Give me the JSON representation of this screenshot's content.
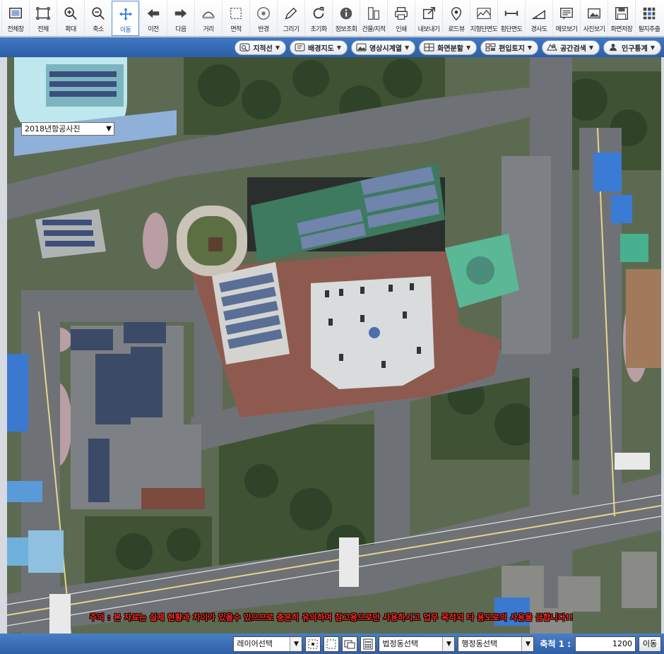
{
  "toolbar": {
    "tools": [
      {
        "label": "전체창",
        "icon": "fullwindow-icon"
      },
      {
        "label": "전체",
        "icon": "full-extent-icon"
      },
      {
        "label": "확대",
        "icon": "zoom-in-icon"
      },
      {
        "label": "축소",
        "icon": "zoom-out-icon"
      },
      {
        "label": "이동",
        "icon": "pan-move-icon",
        "active": true
      },
      {
        "label": "이전",
        "icon": "arrow-left-icon"
      },
      {
        "label": "다음",
        "icon": "arrow-right-icon"
      },
      {
        "label": "거리",
        "icon": "distance-measure-icon"
      },
      {
        "label": "면적",
        "icon": "area-measure-icon"
      },
      {
        "label": "반경",
        "icon": "radius-icon"
      },
      {
        "label": "그리기",
        "icon": "pencil-icon"
      },
      {
        "label": "초기화",
        "icon": "refresh-icon"
      },
      {
        "label": "정보조회",
        "icon": "info-icon"
      },
      {
        "label": "건물/지적",
        "icon": "building-icon"
      },
      {
        "label": "인쇄",
        "icon": "printer-icon"
      },
      {
        "label": "내보내기",
        "icon": "export-icon"
      },
      {
        "label": "로드뷰",
        "icon": "map-pin-icon"
      },
      {
        "label": "지형단면도",
        "icon": "terrain-profile-icon"
      },
      {
        "label": "횡단면도",
        "icon": "cross-section-icon"
      },
      {
        "label": "경사도",
        "icon": "slope-icon"
      },
      {
        "label": "메모보기",
        "icon": "memo-icon"
      },
      {
        "label": "사진보기",
        "icon": "photo-icon"
      },
      {
        "label": "화면저장",
        "icon": "save-disk-icon"
      },
      {
        "label": "필지추출",
        "icon": "parcel-extract-icon"
      }
    ]
  },
  "menubar": {
    "items": [
      {
        "label": "지적선",
        "icon": "cadastral-line-icon"
      },
      {
        "label": "배경지도",
        "icon": "background-map-icon"
      },
      {
        "label": "영상시계열",
        "icon": "image-timeseries-icon"
      },
      {
        "label": "화면분할",
        "icon": "split-screen-icon"
      },
      {
        "label": "편입토지",
        "icon": "incorporated-land-icon"
      },
      {
        "label": "공간검색",
        "icon": "spatial-search-icon"
      },
      {
        "label": "인구통계",
        "icon": "population-icon"
      }
    ]
  },
  "map": {
    "year_select": "2018년항공사진",
    "notice": "주의 : 본 자료는 실제 현황과 차이가 있을수 있으므로 충분히 유의하여 참고용으로만 사용하시고 업무 목적외 타 용도로의 사용을 금합니다!!"
  },
  "bottombar": {
    "layer_select": "레이어선택",
    "legal_dong_select": "법정동선택",
    "admin_dong_select": "행정동선택",
    "scale_label": "축척 1 :",
    "scale_value": "1200",
    "go_label": "이동"
  },
  "colors": {
    "toolbar_bg": "#eef0f3",
    "menubar_bg": "#2c5fa8",
    "active_tool": "#1f5fc0",
    "notice_text": "#ff2a1f"
  }
}
